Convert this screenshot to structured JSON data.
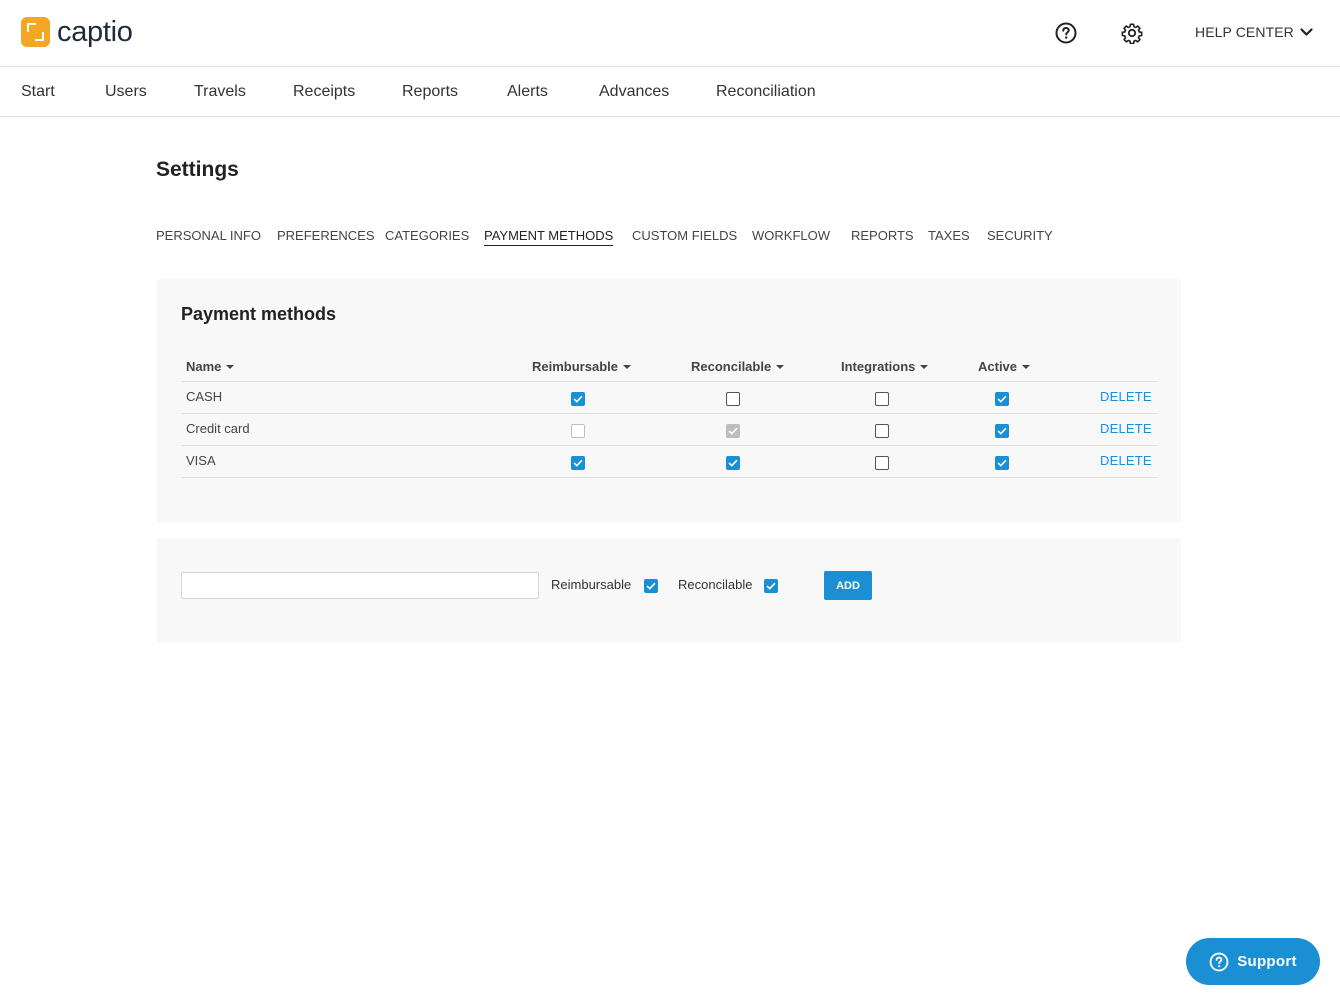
{
  "app": {
    "logo_text": "captio"
  },
  "header": {
    "help_icon": "question-circle-icon",
    "settings_icon": "gear-icon",
    "help_center_label": "HELP CENTER"
  },
  "nav": {
    "items": [
      {
        "label": "Start"
      },
      {
        "label": "Users"
      },
      {
        "label": "Travels"
      },
      {
        "label": "Receipts"
      },
      {
        "label": "Reports"
      },
      {
        "label": "Alerts"
      },
      {
        "label": "Advances"
      },
      {
        "label": "Reconciliation"
      }
    ]
  },
  "page": {
    "title": "Settings"
  },
  "tabs": [
    {
      "label": "PERSONAL INFO",
      "active": false
    },
    {
      "label": "PREFERENCES",
      "active": false
    },
    {
      "label": "CATEGORIES",
      "active": false
    },
    {
      "label": "PAYMENT METHODS",
      "active": true
    },
    {
      "label": "CUSTOM FIELDS",
      "active": false
    },
    {
      "label": "WORKFLOW",
      "active": false
    },
    {
      "label": "REPORTS",
      "active": false
    },
    {
      "label": "TAXES",
      "active": false
    },
    {
      "label": "SECURITY",
      "active": false
    }
  ],
  "payment_methods": {
    "title": "Payment methods",
    "columns": {
      "name": "Name",
      "reimbursable": "Reimbursable",
      "reconcilable": "Reconcilable",
      "integrations": "Integrations",
      "active": "Active"
    },
    "delete_label": "DELETE",
    "rows": [
      {
        "name": "CASH",
        "reimbursable": "checked",
        "reconcilable": "unchecked",
        "integrations": "unchecked",
        "active": "checked"
      },
      {
        "name": "Credit card",
        "reimbursable": "disabled",
        "reconcilable": "disabled-checked",
        "integrations": "unchecked",
        "active": "checked"
      },
      {
        "name": "VISA",
        "reimbursable": "checked",
        "reconcilable": "checked",
        "integrations": "unchecked",
        "active": "checked"
      }
    ]
  },
  "add_form": {
    "input_value": "",
    "input_placeholder": "",
    "reimbursable_label": "Reimbursable",
    "reimbursable_checked": true,
    "reconcilable_label": "Reconcilable",
    "reconcilable_checked": true,
    "add_label": "ADD"
  },
  "support": {
    "label": "Support",
    "icon": "question-circle-icon"
  },
  "colors": {
    "accent": "#1a8fd3",
    "logo": "#f5a623"
  }
}
